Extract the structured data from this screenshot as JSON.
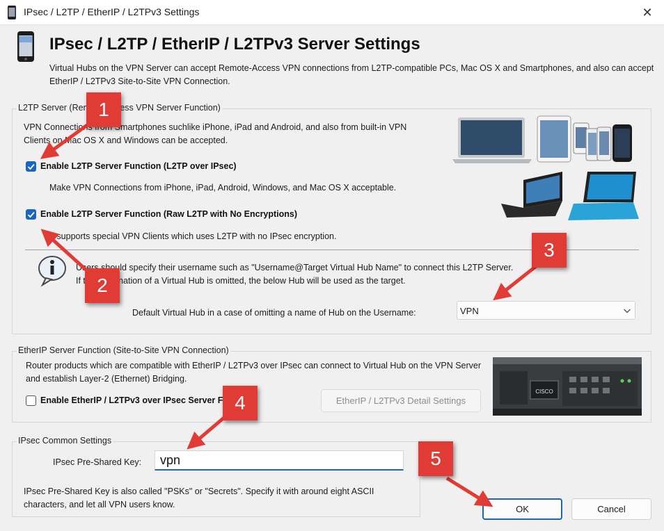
{
  "window": {
    "title": "IPsec / L2TP / EtherIP / L2TPv3 Settings",
    "close_glyph": "✕"
  },
  "header": {
    "title": "IPsec / L2TP / EtherIP / L2TPv3 Server Settings",
    "description": "Virtual Hubs on the VPN Server can accept Remote-Access VPN connections from L2TP-compatible PCs, Mac OS X and Smartphones, and also can accept EtherIP / L2TPv3 Site-to-Site VPN Connection.",
    "icon": "smartphone-icon"
  },
  "l2tp": {
    "legend": "L2TP Server (Remote-Access VPN Server Function)",
    "desc": "VPN Connections from Smartphones suchlike iPhone, iPad and Android, and also from built-in VPN Clients on Mac OS X and Windows can be accepted.",
    "ipsec_checkbox_label": "Enable L2TP Server Function (L2TP over IPsec)",
    "ipsec_checked": true,
    "ipsec_desc": "Make VPN Connections from iPhone, iPad, Android, Windows, and Mac OS X acceptable.",
    "raw_checkbox_label": "Enable L2TP Server Function (Raw L2TP with No Encryptions)",
    "raw_checked": true,
    "raw_desc": "It supports special VPN Clients which uses L2TP with no IPsec encryption.",
    "info_line1": "Users should specify their username such as \"Username@Target Virtual Hub Name\" to connect this L2TP Server.",
    "info_line2": "If the designation of a Virtual Hub is omitted, the below Hub will be used as the target.",
    "default_hub_label": "Default Virtual Hub in a case of omitting a name of Hub on the Username:",
    "default_hub_value": "VPN"
  },
  "etherip": {
    "legend": "EtherIP Server Function (Site-to-Site VPN Connection)",
    "desc": "Router products which are compatible with EtherIP / L2TPv3 over IPsec can connect to Virtual Hub on the VPN Server and establish Layer-2 (Ethernet) Bridging.",
    "checkbox_label": "Enable EtherIP / L2TPv3 over IPsec Server Function",
    "checked": false,
    "detail_button": "EtherIP / L2TPv3 Detail Settings",
    "router_brand": "CISCO"
  },
  "ipsec": {
    "legend": "IPsec Common Settings",
    "psk_label": "IPsec Pre-Shared Key:",
    "psk_value": "vpn",
    "psk_desc": "IPsec Pre-Shared Key is also called \"PSKs\" or \"Secrets\". Specify it with around eight ASCII characters, and let all VPN users know."
  },
  "buttons": {
    "ok": "OK",
    "cancel": "Cancel"
  },
  "annotations": {
    "badges": [
      "1",
      "2",
      "3",
      "4",
      "5"
    ],
    "color": "#e03b34"
  },
  "colors": {
    "accent": "#1a64c2",
    "window_bg": "#f0f0f0"
  }
}
